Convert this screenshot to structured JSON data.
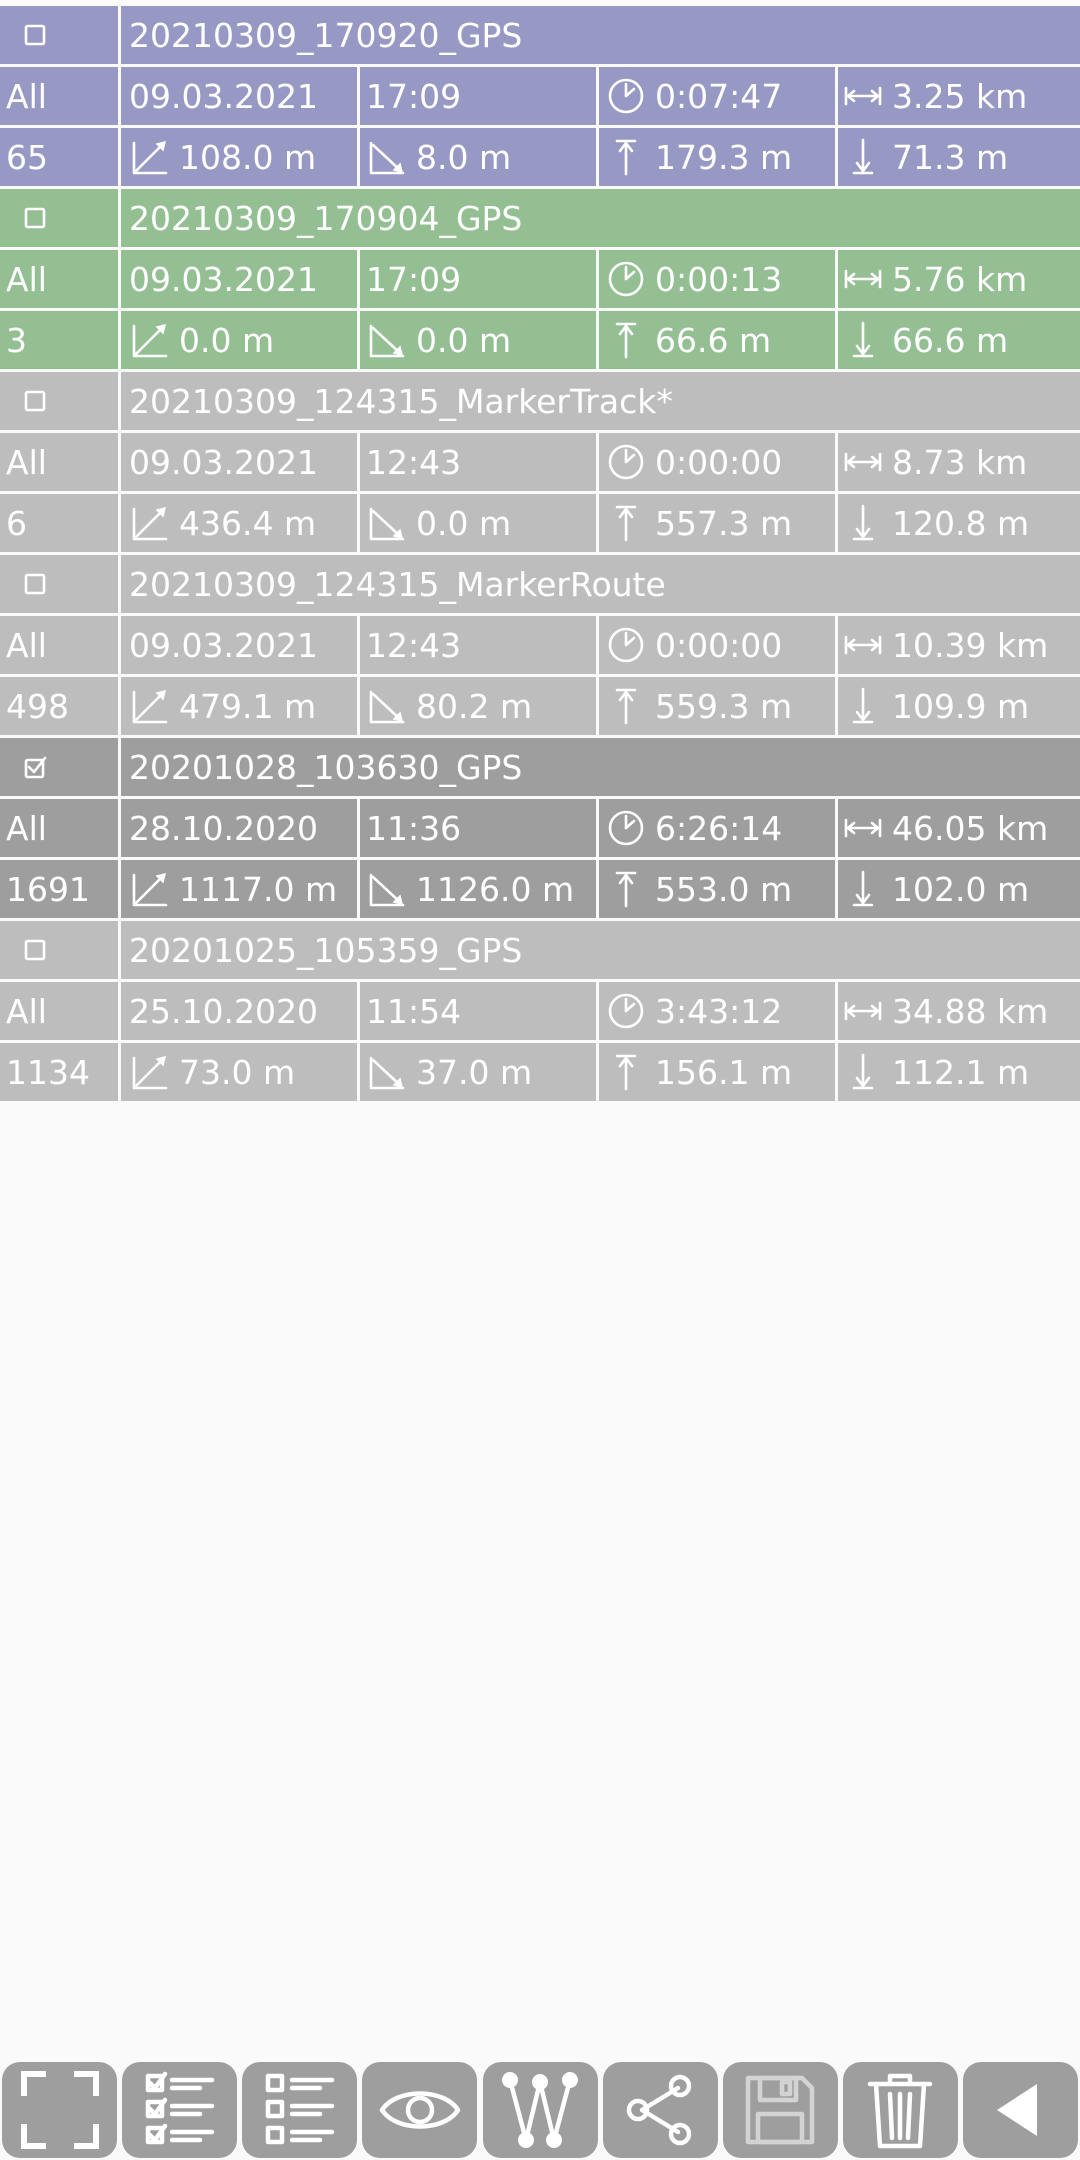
{
  "colors": {
    "track_0": "#9898c4",
    "track_1": "#93bf93",
    "track_2": "#bdbdbd",
    "track_3": "#bdbdbd",
    "track_4": "#9e9e9e",
    "track_5": "#bdbdbd",
    "toolbar_button": "#9e9e9e",
    "background": "#fafafa"
  },
  "tracks": [
    {
      "name": "20210309_170920_GPS",
      "selected": false,
      "filter": "All",
      "date": "09.03.2021",
      "time": "17:09",
      "duration": "0:07:47",
      "distance": "3.25 km",
      "points": "65",
      "ascent": "108.0 m",
      "descent": "8.0 m",
      "max_alt": "179.3 m",
      "min_alt": "71.3 m"
    },
    {
      "name": "20210309_170904_GPS",
      "selected": false,
      "filter": "All",
      "date": "09.03.2021",
      "time": "17:09",
      "duration": "0:00:13",
      "distance": "5.76 km",
      "points": "3",
      "ascent": "0.0 m",
      "descent": "0.0 m",
      "max_alt": "66.6 m",
      "min_alt": "66.6 m"
    },
    {
      "name": "20210309_124315_MarkerTrack*",
      "selected": false,
      "filter": "All",
      "date": "09.03.2021",
      "time": "12:43",
      "duration": "0:00:00",
      "distance": "8.73 km",
      "points": "6",
      "ascent": "436.4 m",
      "descent": "0.0 m",
      "max_alt": "557.3 m",
      "min_alt": "120.8 m"
    },
    {
      "name": "20210309_124315_MarkerRoute",
      "selected": false,
      "filter": "All",
      "date": "09.03.2021",
      "time": "12:43",
      "duration": "0:00:00",
      "distance": "10.39 km",
      "points": "498",
      "ascent": "479.1 m",
      "descent": "80.2 m",
      "max_alt": "559.3 m",
      "min_alt": "109.9 m"
    },
    {
      "name": "20201028_103630_GPS",
      "selected": true,
      "filter": "All",
      "date": "28.10.2020",
      "time": "11:36",
      "duration": "6:26:14",
      "distance": "46.05 km",
      "points": "1691",
      "ascent": "1117.0 m",
      "descent": "1126.0 m",
      "max_alt": "553.0 m",
      "min_alt": "102.0 m"
    },
    {
      "name": "20201025_105359_GPS",
      "selected": false,
      "filter": "All",
      "date": "25.10.2020",
      "time": "11:54",
      "duration": "3:43:12",
      "distance": "34.88 km",
      "points": "1134",
      "ascent": "73.0 m",
      "descent": "37.0 m",
      "max_alt": "156.1 m",
      "min_alt": "112.1 m"
    }
  ],
  "toolbar": [
    {
      "icon": "fullscreen-icon",
      "enabled": true
    },
    {
      "icon": "select-all-icon",
      "enabled": true
    },
    {
      "icon": "deselect-all-icon",
      "enabled": true
    },
    {
      "icon": "eye-icon",
      "enabled": true
    },
    {
      "icon": "waypoints-icon",
      "enabled": true
    },
    {
      "icon": "share-icon",
      "enabled": true
    },
    {
      "icon": "save-icon",
      "enabled": false
    },
    {
      "icon": "trash-icon",
      "enabled": true
    },
    {
      "icon": "back-arrow-icon",
      "enabled": true
    }
  ]
}
